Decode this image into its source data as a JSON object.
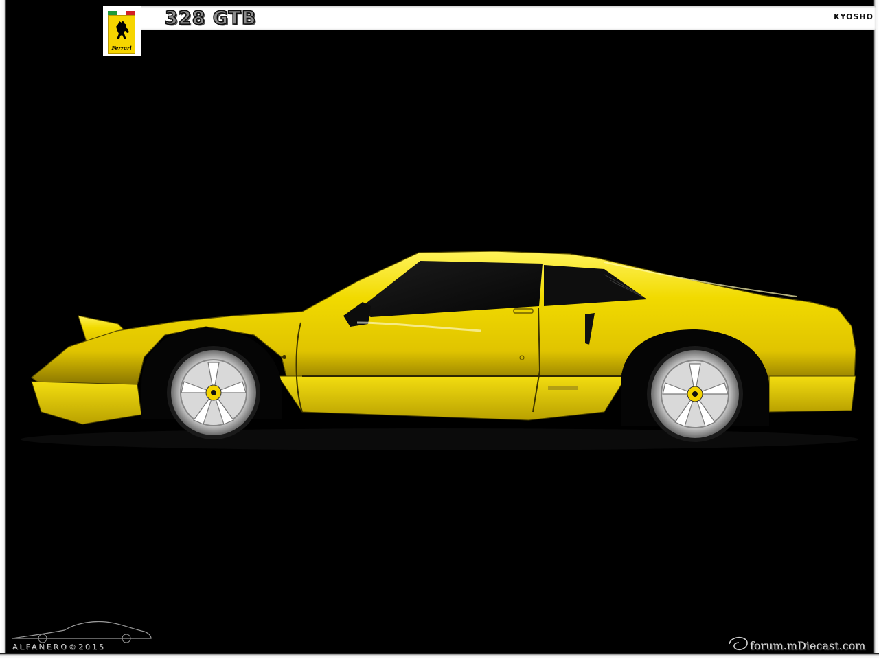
{
  "header": {
    "badge_text": "Ferrari",
    "title": "328 GTB",
    "maker": "KYOSHO"
  },
  "footer": {
    "signature": "ALFANERO©2015",
    "watermark": "forum.mDiecast.com"
  },
  "colors": {
    "car_body": "#f2dc00",
    "background": "#000000",
    "header_bg": "#ffffff",
    "badge_yellow": "#f6d500",
    "flag_green": "#1f9a3a",
    "flag_white": "#ffffff",
    "flag_red": "#d21f26"
  },
  "icons": {
    "badge": "prancing-horse-shield-icon",
    "watermark": "mdiecast-swirl-icon",
    "signature": "car-silhouette-icon"
  }
}
